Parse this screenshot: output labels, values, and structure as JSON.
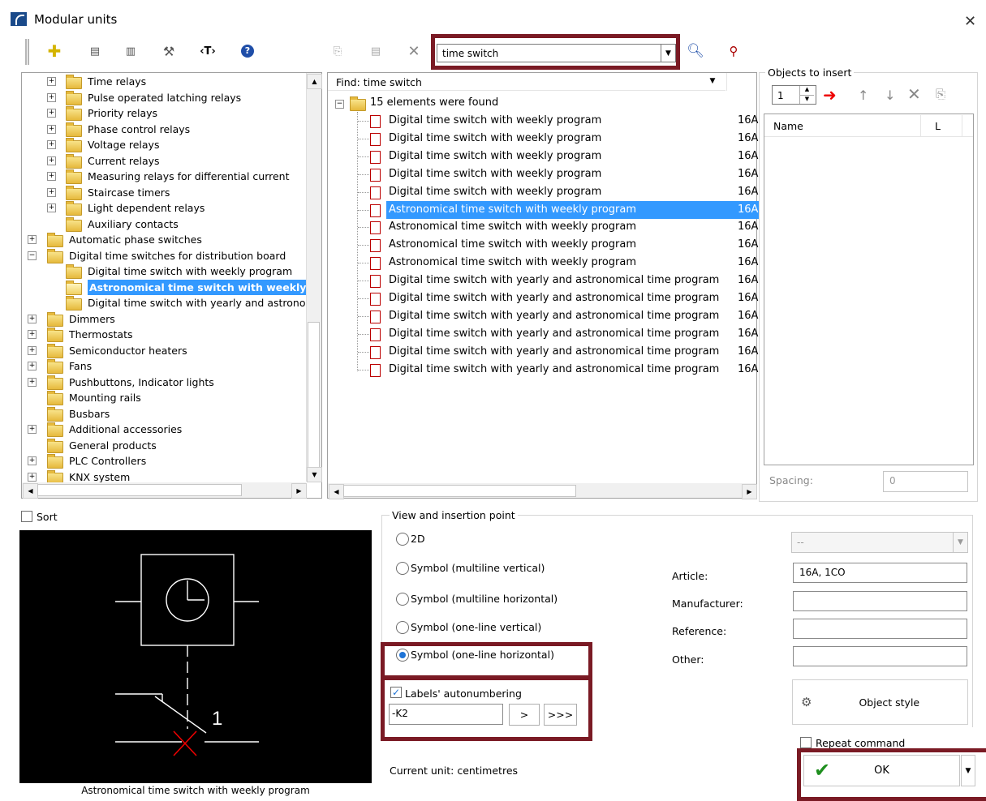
{
  "window": {
    "title": "Modular units",
    "close_icon": "close-icon"
  },
  "search": {
    "value": "time switch"
  },
  "tree": {
    "items": [
      {
        "label": "Time relays",
        "level": 1,
        "expand": true
      },
      {
        "label": "Pulse operated latching relays",
        "level": 1,
        "expand": true
      },
      {
        "label": "Priority relays",
        "level": 1,
        "expand": true
      },
      {
        "label": "Phase control relays",
        "level": 1,
        "expand": true
      },
      {
        "label": "Voltage relays",
        "level": 1,
        "expand": true
      },
      {
        "label": "Current relays",
        "level": 1,
        "expand": true
      },
      {
        "label": "Measuring relays for differential current",
        "level": 1,
        "expand": true
      },
      {
        "label": "Staircase timers",
        "level": 1,
        "expand": true
      },
      {
        "label": "Light dependent relays",
        "level": 1,
        "expand": true
      },
      {
        "label": "Auxiliary contacts",
        "level": 1,
        "expand": false
      },
      {
        "label": "Automatic phase switches",
        "level": 0,
        "expand": true
      },
      {
        "label": "Digital time switches for distribution board",
        "level": 0,
        "expand": true,
        "open": true
      },
      {
        "label": "Digital time switch with weekly program",
        "level": 1,
        "expand": false
      },
      {
        "label": "Astronomical time switch with weekly pr",
        "level": 1,
        "expand": false,
        "selected": true
      },
      {
        "label": "Digital time switch with yearly and astronomical",
        "level": 1,
        "expand": false
      },
      {
        "label": "Dimmers",
        "level": 0,
        "expand": true
      },
      {
        "label": "Thermostats",
        "level": 0,
        "expand": true
      },
      {
        "label": "Semiconductor heaters",
        "level": 0,
        "expand": true
      },
      {
        "label": "Fans",
        "level": 0,
        "expand": true
      },
      {
        "label": "Pushbuttons, Indicator lights",
        "level": 0,
        "expand": true
      },
      {
        "label": "Mounting rails",
        "level": 0,
        "expand": false
      },
      {
        "label": "Busbars",
        "level": 0,
        "expand": false
      },
      {
        "label": "Additional accessories",
        "level": 0,
        "expand": true
      },
      {
        "label": "General products",
        "level": 0,
        "expand": false
      },
      {
        "label": "PLC Controllers",
        "level": 0,
        "expand": true
      },
      {
        "label": "KNX system",
        "level": 0,
        "expand": true
      }
    ]
  },
  "results": {
    "header": "Find: time switch",
    "root": "15 elements were found",
    "rows": [
      {
        "name": "Digital time switch with weekly program",
        "rating": "16A"
      },
      {
        "name": "Digital time switch with weekly program",
        "rating": "16A"
      },
      {
        "name": "Digital time switch with weekly program",
        "rating": "16A"
      },
      {
        "name": "Digital time switch with weekly program",
        "rating": "16A"
      },
      {
        "name": "Digital time switch with weekly program",
        "rating": "16A"
      },
      {
        "name": "Astronomical time switch with weekly program",
        "rating": "16A",
        "selected": true
      },
      {
        "name": "Astronomical time switch with weekly program",
        "rating": "16A"
      },
      {
        "name": "Astronomical time switch with weekly program",
        "rating": "16A"
      },
      {
        "name": "Astronomical time switch with weekly program",
        "rating": "16A"
      },
      {
        "name": "Digital time switch with yearly and astronomical time program",
        "rating": "16A"
      },
      {
        "name": "Digital time switch with yearly and astronomical time program",
        "rating": "16A"
      },
      {
        "name": "Digital time switch with yearly and astronomical time program",
        "rating": "16A"
      },
      {
        "name": "Digital time switch with yearly and astronomical time program",
        "rating": "16A"
      },
      {
        "name": "Digital time switch with yearly and astronomical time program",
        "rating": "16A"
      },
      {
        "name": "Digital time switch with yearly and astronomical time program",
        "rating": "16A"
      }
    ]
  },
  "objects": {
    "title": "Objects to insert",
    "count": "1",
    "col_name": "Name",
    "col_l": "L",
    "spacing_label": "Spacing:",
    "spacing_value": "0"
  },
  "sort_label": "Sort",
  "preview_caption": "Astronomical time switch with weekly program",
  "preview_symbol_label": "1",
  "view": {
    "title": "View and insertion point",
    "options": [
      "2D",
      "Symbol (multiline vertical)",
      "Symbol (multiline horizontal)",
      "Symbol (one-line vertical)",
      "Symbol (one-line horizontal)"
    ],
    "selected_index": 4,
    "dropdown_value": "--",
    "article_label": "Article:",
    "article_value": "16A, 1CO",
    "manufacturer_label": "Manufacturer:",
    "reference_label": "Reference:",
    "other_label": "Other:",
    "object_style": "Object style"
  },
  "autonum": {
    "label": "Labels' autonumbering",
    "value": "-K2",
    "next": ">",
    "all": ">>>"
  },
  "repeat_label": "Repeat command",
  "current_unit": "Current unit: centimetres",
  "ok_label": "OK"
}
